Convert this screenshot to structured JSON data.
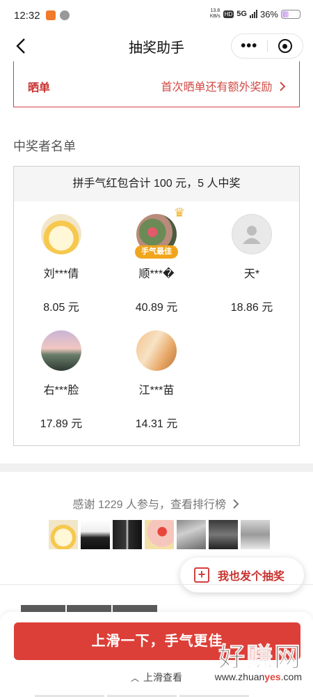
{
  "status_bar": {
    "time": "12:32",
    "net_speed_top": "13.8",
    "net_speed_unit": "KB/s",
    "hd": "HD",
    "network": "5G",
    "battery": "36%",
    "battery_level": 0.36
  },
  "nav": {
    "title": "抽奖助手",
    "more_label": "•••"
  },
  "show_box": {
    "label": "晒单",
    "hint": "首次晒单还有额外奖励"
  },
  "winners": {
    "section_title": "中奖者名单",
    "summary": "拼手气红包合计 100 元，5 人中奖",
    "best_badge": "手气最佳",
    "list": [
      {
        "name": "刘***倩",
        "amount": "8.05 元"
      },
      {
        "name": "顺***�",
        "amount": "40.89 元"
      },
      {
        "name": "天*",
        "amount": "18.86 元"
      },
      {
        "name": "右***脸",
        "amount": "17.89 元"
      },
      {
        "name": "江***苗",
        "amount": "14.31 元"
      }
    ]
  },
  "participants": {
    "thanks": "感谢 1229 人参与，查看排行榜"
  },
  "fab": {
    "label": "我也发个抽奖"
  },
  "bottom": {
    "cta": "上滑一下，手气更佳",
    "swipe_hint": "上滑查看"
  },
  "watermark": {
    "cn": "好赚网",
    "url_prefix": "www.zhuan",
    "url_mid": "yes",
    "url_suffix": ".com"
  }
}
